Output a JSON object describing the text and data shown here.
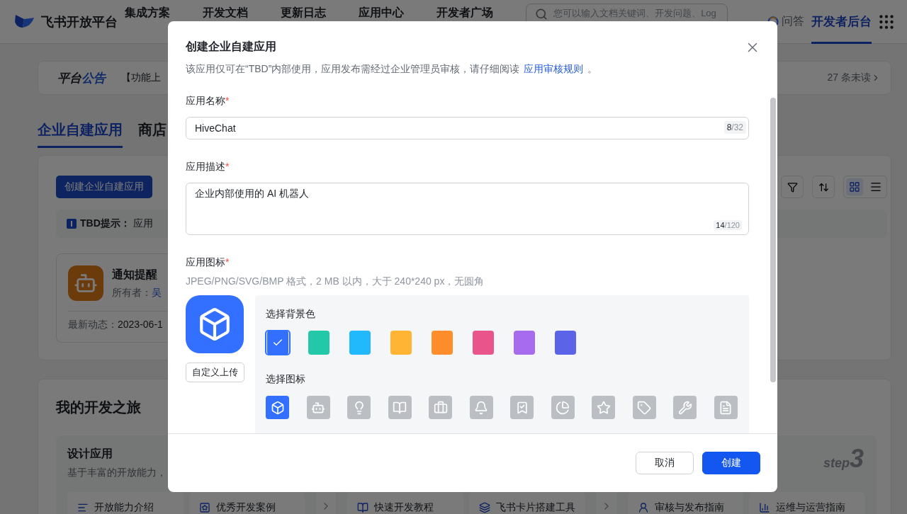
{
  "top_nav": {
    "brand": "飞书开放平台",
    "items": [
      "集成方案",
      "开发文档",
      "更新日志",
      "应用中心",
      "开发者广场"
    ],
    "search": {
      "placeholder": "您可以输入文档关键词、开发问题、Log"
    },
    "qa": "问答",
    "console": {
      "label": "开发者后台",
      "selected": true
    }
  },
  "announcement": {
    "title_plain": "平台",
    "title_accent": "公告",
    "text": "【功能上",
    "unread": "27 条未读"
  },
  "tabs": [
    {
      "label": "企业自建应用",
      "selected": true
    },
    {
      "label": "商店",
      "selected": false
    }
  ],
  "apps_panel": {
    "create_button": "创建企业自建应用",
    "view_modes": [
      {
        "kind": "grid",
        "selected": true
      },
      {
        "kind": "list",
        "selected": false
      }
    ],
    "tip": {
      "label": "TBD提示：",
      "text": "应用"
    },
    "app_card": {
      "name": "通知提醒",
      "owner_label": "所有者：",
      "owner": "吴",
      "latest_label": "最新动态：",
      "latest": "2023-06-1"
    }
  },
  "journey": {
    "title": "我的开发之旅",
    "steps": [
      {
        "title": "设计应用",
        "description": "基于丰富的开放能力，",
        "items": [
          {
            "kind": "doc",
            "label": "开放能力介绍"
          },
          {
            "kind": "star",
            "label": "优秀开发案例"
          }
        ]
      },
      {
        "items": [
          {
            "kind": "book",
            "label": "快速开发教程"
          },
          {
            "kind": "cards",
            "label": "飞书卡片搭建工具"
          }
        ]
      },
      {
        "step_word": "step",
        "step_number": "3",
        "items": [
          {
            "kind": "person",
            "label": "审核与发布指南"
          },
          {
            "kind": "chart",
            "label": "运维与运营指南"
          }
        ]
      }
    ]
  },
  "dialog": {
    "title": "创建企业自建应用",
    "notice": "该应用仅可在“TBD”内部使用，应用发布需经过企业管理员审核，请仔细阅读",
    "notice_link": "应用审核规则",
    "notice_end": "。",
    "name_field": {
      "label": "应用名称",
      "required_mark": "*",
      "value": "HiveChat",
      "count": "8",
      "limit": "/32"
    },
    "description_field": {
      "label": "应用描述",
      "required_mark": "*",
      "value": "企业内部使用的 AI 机器人",
      "count": "14",
      "limit": "/120"
    },
    "icon_field": {
      "label": "应用图标",
      "required_mark": "*",
      "hint": "JPEG/PNG/SVG/BMP 格式，2 MB 以内，大于 240*240 px，无圆角",
      "upload_button": "自定义上传",
      "color_title": "选择背景色",
      "colors": [
        {
          "color": "#3370ff",
          "selected": true
        },
        {
          "color": "#22c8a8",
          "selected": false
        },
        {
          "color": "#22b8fc",
          "selected": false
        },
        {
          "color": "#ffb433",
          "selected": false
        },
        {
          "color": "#ff8d2b",
          "selected": false
        },
        {
          "color": "#e9548a",
          "selected": false
        },
        {
          "color": "#a76cee",
          "selected": false
        },
        {
          "color": "#5b63e6",
          "selected": false
        }
      ],
      "icon_title": "选择图标",
      "icons": [
        {
          "kind": "cube",
          "selected": true
        },
        {
          "kind": "robot",
          "selected": false
        },
        {
          "kind": "bulb",
          "selected": false
        },
        {
          "kind": "book",
          "selected": false
        },
        {
          "kind": "briefcase",
          "selected": false
        },
        {
          "kind": "bell",
          "selected": false
        },
        {
          "kind": "bookmark",
          "selected": false
        },
        {
          "kind": "pie",
          "selected": false
        },
        {
          "kind": "star",
          "selected": false
        },
        {
          "kind": "tag",
          "selected": false
        },
        {
          "kind": "wrench",
          "selected": false
        },
        {
          "kind": "file",
          "selected": false
        }
      ]
    },
    "buttons": [
      {
        "kind": "secondary",
        "label": "取消"
      },
      {
        "kind": "primary",
        "label": "创建"
      }
    ]
  }
}
